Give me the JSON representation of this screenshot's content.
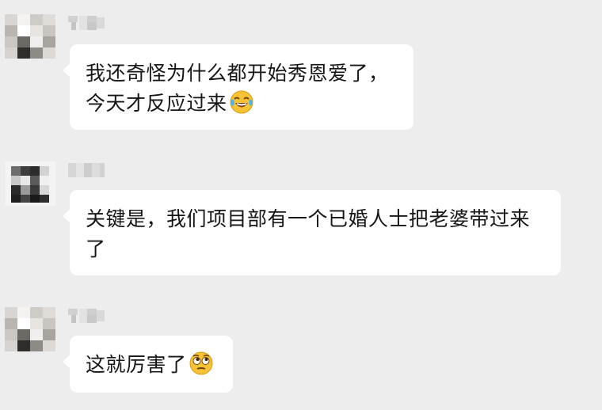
{
  "messages": [
    {
      "sender": "teammate-1",
      "lines": [
        "我还奇怪为什么都开始秀恩爱了，",
        "今天才反应过来"
      ],
      "emoji": "crying-laughing-emoji"
    },
    {
      "sender": "teammate-2",
      "lines": [
        "关键是，我们项目部有一个已婚人士把老婆带过来",
        "了"
      ],
      "emoji": ""
    },
    {
      "sender": "teammate-1",
      "lines": [
        "这就厉害了"
      ],
      "emoji": "rolling-eyes-emoji"
    }
  ],
  "colors": {
    "background": "#ededed",
    "bubble": "#ffffff",
    "text": "#161616"
  }
}
